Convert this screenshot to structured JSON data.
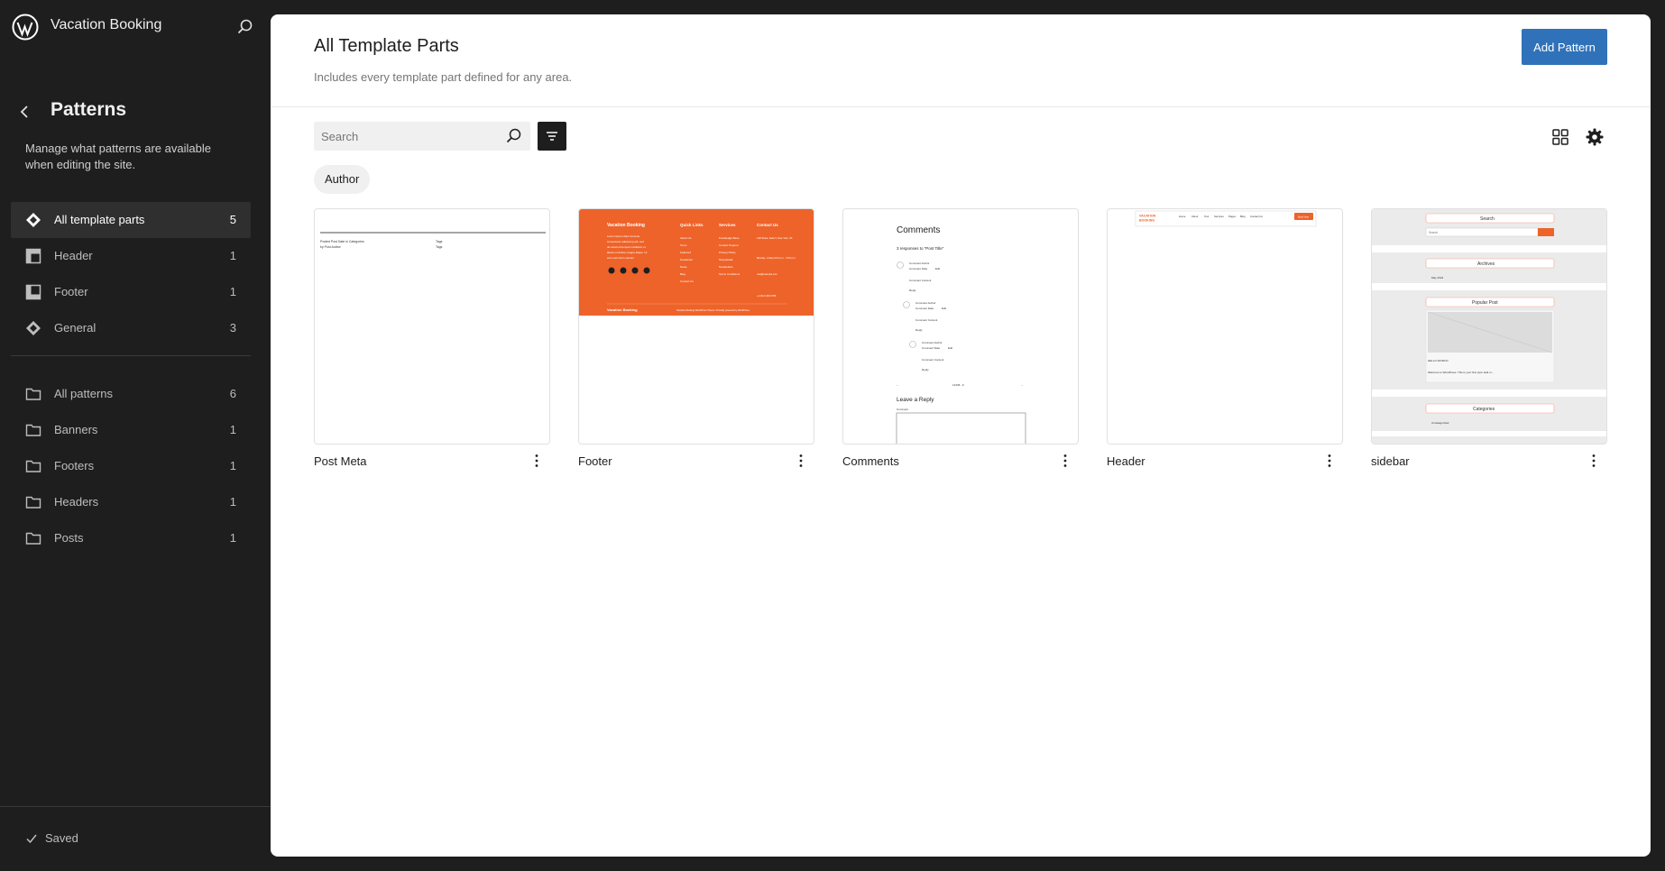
{
  "site": {
    "title": "Vacation Booking"
  },
  "sidebar": {
    "title": "Patterns",
    "description": "Manage what patterns are available when editing the site.",
    "template_parts": [
      {
        "label": "All template parts",
        "count": "5",
        "icon": "symbol-filled-icon",
        "active": true
      },
      {
        "label": "Header",
        "count": "1",
        "icon": "header-icon"
      },
      {
        "label": "Footer",
        "count": "1",
        "icon": "footer-icon"
      },
      {
        "label": "General",
        "count": "3",
        "icon": "symbol-filled-icon"
      }
    ],
    "categories": [
      {
        "label": "All patterns",
        "count": "6",
        "icon": "folder-icon"
      },
      {
        "label": "Banners",
        "count": "1",
        "icon": "folder-icon"
      },
      {
        "label": "Footers",
        "count": "1",
        "icon": "folder-icon"
      },
      {
        "label": "Headers",
        "count": "1",
        "icon": "folder-icon"
      },
      {
        "label": "Posts",
        "count": "1",
        "icon": "folder-icon"
      }
    ],
    "saved_label": "Saved"
  },
  "main": {
    "title": "All Template Parts",
    "subtitle": "Includes every template part defined for any area.",
    "add_button": "Add Pattern",
    "search_placeholder": "Search",
    "author_filter": "Author",
    "cards": [
      {
        "title": "Post Meta"
      },
      {
        "title": "Footer"
      },
      {
        "title": "Comments"
      },
      {
        "title": "Header"
      },
      {
        "title": "sidebar"
      }
    ]
  },
  "previews": {
    "post_meta": {
      "line1": "Posted Post Date in Categories",
      "line2": "by Post Author",
      "tags": "Tags"
    },
    "footer": {
      "brand": "Vacation Booking",
      "about": "Lorem ipsum dolor sit amet, consectetur adipiscing elit, sed do eiusmod tempor incididunt ut labore et dolore magna aliqua. Ut enim ad minim veniam",
      "quick_links_title": "Quick Links",
      "quick_links": [
        "About Us",
        "Tours",
        "Featured",
        "Newsletter",
        "News",
        "Blog",
        "Contact Us"
      ],
      "services_title": "Services",
      "services": [
        "Knowledge Base",
        "Contact Support",
        "Privacy Policy",
        "Shopdetails",
        "Newsletters",
        "Terms Conditions"
      ],
      "contact_title": "Contact Us",
      "contact": [
        "13D Street, Suite 5, New York, US",
        "Monday - Friday 9:00 a.m. - 5:00 p.m.",
        "mail@example.com",
        "+1 (012) 345 6789"
      ],
      "bottom_brand": "Vacation Booking",
      "copyright": "Vacation Booking WordPress Theme / Proudly powered by WordPress",
      "accent": "#ee6329"
    },
    "comments": {
      "title": "Comments",
      "responses": "3 responses to “Post Title”",
      "author": "Comment Author",
      "date": "Comment Date",
      "edit": "Edit",
      "content": "Comment Content",
      "reply": "Reply",
      "pagination": "12345...9",
      "leave_reply": "Leave a Reply",
      "comment_label": "Comment"
    },
    "header": {
      "logo": "VACATION BOOKING",
      "nav": [
        "Home",
        "About",
        "Tour",
        "Services",
        "Pages",
        "Blog",
        "Contact Us"
      ],
      "cta": "Book Now"
    },
    "sidebar": {
      "search_title": "Search",
      "search_placeholder": "Search",
      "archives_title": "Archives",
      "archive_item": "May 2024",
      "popular_title": "Popular Post",
      "post_title": "HELLO WORLD!",
      "post_excerpt": "Welcome to WordPress. This is your first post. Edit or…",
      "categories_title": "Categories",
      "category_item": "Uncategorized"
    }
  },
  "colors": {
    "sidebar_bg": "#1e1e1e",
    "accent": "#3072b9",
    "theme_orange": "#ee6329"
  }
}
